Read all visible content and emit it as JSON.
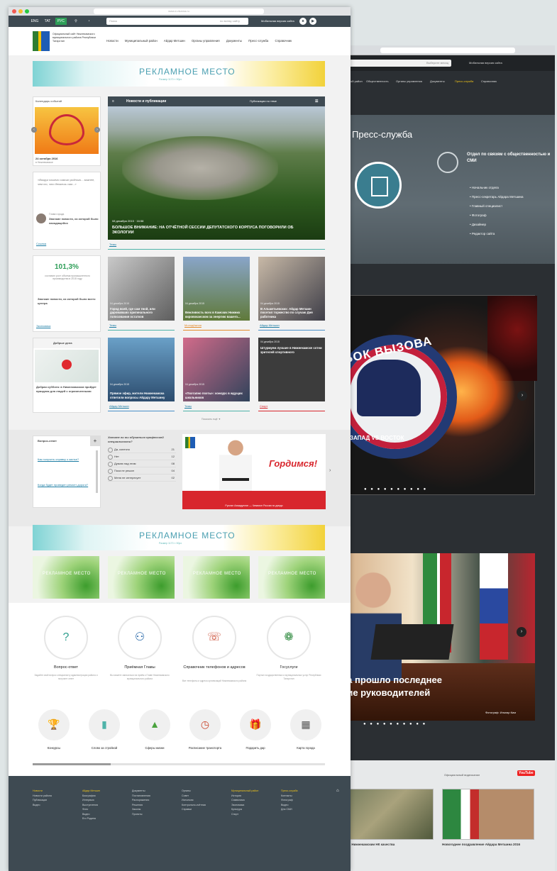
{
  "back": {
    "mver": "Мобильная версия сайта",
    "sort": "Выберите месяц",
    "menu": [
      "Муниципальный район",
      "Общественность",
      "Органы управления",
      "Документы",
      "Пресс-служба",
      "Справочник"
    ],
    "menu_active": "Пресс-служба",
    "press_title": "Пресс-служба",
    "dept_title": "Отдел по связям с общественностью и СМИ",
    "dept_links": [
      "Начальник отдела",
      "Пресс-секретарь Айдара Метшина",
      "Главный специалист",
      "Фотограф",
      "Дизайнер",
      "Редактор сайта"
    ],
    "puck_text": "УБОК ВЫЗОВА",
    "puck_sub": "ЗАПАД VS ВОСТОК",
    "slide2_title_l1": "мска прошло последнее",
    "slide2_title_l2": "дание руководителей",
    "slide2_caption": "Фотограф: Ильнар Ким",
    "yt_label": "Официальный видеоканал",
    "yt_logo": "YouTube",
    "video1": "...икатуры к Нижнекамскии НК качества",
    "video2": "Новогоднее поздравление Айдара Метшина 2016",
    "slide_dots": "● ● ● ● ● ● ● ● ● ●"
  },
  "front": {
    "url": "www.e-nkama.ru",
    "top_icons": [
      "ENG",
      "TAT",
      "РУС"
    ],
    "search_placeholder": "Поиск",
    "search_hint": "по всему сайту",
    "mobile": "Мобильная версия сайта",
    "logo_text": "Официальный сайт Нижнекамского муниципального района Республики Татарстан",
    "nav": [
      "Новости",
      "Муниципальный район",
      "Айдар Метшин",
      "Органы управления",
      "Документы",
      "Пресс-служба",
      "Справочник"
    ],
    "ad_title": "РЕКЛАМНОЕ МЕСТО",
    "ad_sub": "Размер 1170 × 90px",
    "left": {
      "box1_title": "Календарь событий",
      "box1_date": "24 октября 2016",
      "box1_text": "в Нижнекамске",
      "quote": "«Вокруг нашего самого родного... важнее, чем то, что делаешь сам...»",
      "author_label": "Глава города",
      "author_news": "Звонкие новости, из которой было находящейся",
      "author_link": "Ссылка",
      "stat_value": "101,3%",
      "stat_text": "составил рост объема промышленного производства в 2015 году",
      "stat_news": "Звонкие новости, из которой было всего центра",
      "stat_link": "Экономика",
      "kind_title": "Добрые дела",
      "kind_news": "Добрая суббота: в Нижнекамском пройдет праздник для людей с ограниченными"
    },
    "news_title": "Новости и публикации",
    "news_sub": "Публикации по теме",
    "main_date": "08 декабря 2015 · 16:58",
    "main_caption": "БОЛЬШОЕ ВНИМАНИЕ: НА ОТЧЁТНОЙ СЕССИИ ДЕПУТАТСКОГО КОРПУСА ПОГОВОРИЛИ ОБ ЭКОЛОГИИ",
    "main_tag": "Темы",
    "tiles": [
      {
        "date": "04 декабря 2015",
        "cap": "Город всей, где сам твой, или даровавших оригинального голосования остатков",
        "tag": "Темы"
      },
      {
        "date": "04 декабря 2015",
        "cap": "Вежливость всех в Камских Нижних кировоканском за энергию вашего...",
        "tag": "Молодёжная"
      },
      {
        "date": "04 декабря 2015",
        "cap": "В Альметьевских: Айдар Метшин посетил торжество по случаю Дня работника",
        "tag": "Айдар Метшин"
      },
      {
        "date": "04 декабря 2015",
        "cap": "Прямое эфир, жители Нижнекамска ответили вопросы Айдару Метшину",
        "tag": "Айдар Метшин"
      },
      {
        "date": "04 декабря 2015",
        "cap": "«Поэтапно поэты»: конкурс в ждущих школьников",
        "tag": "Темы"
      },
      {
        "date": "04 декабря 2015",
        "cap": "Штурмуем лучшие в Нижнекамске сотни зрителей спортивного",
        "tag": "Спорт"
      }
    ],
    "more": "Показать ещё ▼",
    "qa_title": "Вопрос-ответ",
    "qa_items": [
      "Как получить справку о жилье?",
      "Когда будет проведен ремонт дороги?"
    ],
    "poll_title": "Хотите ли вы обучаться профессией специальности?",
    "poll_options": [
      {
        "label": "Да, конечно",
        "n": "21"
      },
      {
        "label": "Нет",
        "n": "12"
      },
      {
        "label": "Думаю над этим",
        "n": "08"
      },
      {
        "label": "Пока не решил",
        "n": "04"
      },
      {
        "label": "Меня не интересует",
        "n": "02"
      }
    ],
    "proud_title": "Гордимся!",
    "proud_text": "Руслан Ахмадуллин — Чемпион России по дзюдо",
    "green_ad": "РЕКЛАМНОЕ МЕСТО",
    "services": [
      {
        "title": "Вопрос-ответ",
        "desc": "Задайте свой вопрос специалисту администрации района и получите ответ",
        "icon": "?"
      },
      {
        "title": "Приёмная Главы",
        "desc": "Вы можете записаться на приём к Главе Нижнекамского муниципального района",
        "icon": "⚇"
      },
      {
        "title": "Справочник телефонов и адресов",
        "desc": "Все телефоны и адреса организаций Нижнекамского района",
        "icon": "☏"
      },
      {
        "title": "Госуслуги",
        "desc": "Портал государственных и муниципальных услуг Республики Татарстан",
        "icon": "❁"
      }
    ],
    "mini": [
      {
        "title": "Конкурсы",
        "icon": "🏆"
      },
      {
        "title": "Слово за стройкой",
        "icon": "▮"
      },
      {
        "title": "Сферы жизни",
        "icon": "▲"
      },
      {
        "title": "Расписание транспорта",
        "icon": "◷"
      },
      {
        "title": "Подарить дар",
        "icon": "🎁"
      },
      {
        "title": "Карта города",
        "icon": "▦"
      }
    ],
    "footer": [
      {
        "head": "Новости",
        "items": [
          "Новости района",
          "Публикации",
          "Видео"
        ]
      },
      {
        "head": "Айдар Метшин",
        "items": [
          "Биография",
          "Интервью",
          "Выступления",
          "Фото",
          "Видео",
          "Его Родина"
        ]
      },
      {
        "head": "",
        "items": [
          "Документы",
          "Постановления",
          "Распоряжения",
          "Решения",
          "Законы",
          "Проекты"
        ]
      },
      {
        "head": "",
        "items": [
          "Органы",
          "Совет",
          "Исполком",
          "Контрольно-счётная",
          "Справки"
        ]
      },
      {
        "head": "Муниципальный район",
        "items": [
          "История",
          "Символика",
          "Экономика",
          "Культура",
          "Спорт"
        ]
      },
      {
        "head": "Пресс-служба",
        "items": [
          "Контакты",
          "Фотограф",
          "Видео",
          "Для СМИ"
        ]
      }
    ]
  }
}
